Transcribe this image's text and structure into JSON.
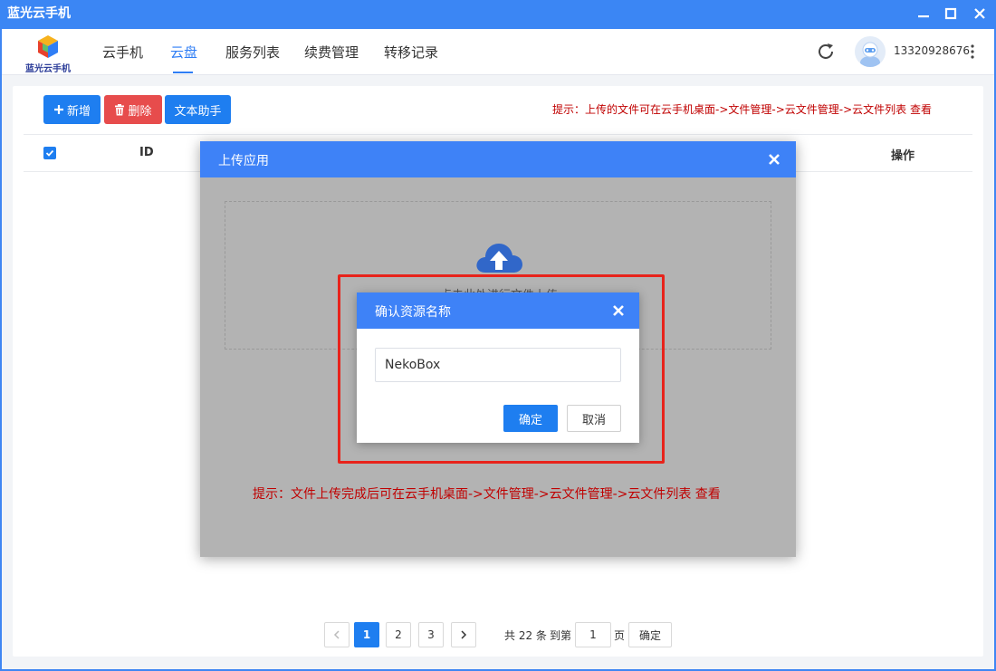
{
  "window": {
    "title": "蓝光云手机",
    "minimize_icon": "minimize-icon",
    "maximize_icon": "maximize-icon",
    "close_icon": "close-icon"
  },
  "header": {
    "logo_text": "蓝光云手机",
    "nav": [
      {
        "label": "云手机",
        "active": false
      },
      {
        "label": "云盘",
        "active": true
      },
      {
        "label": "服务列表",
        "active": false
      },
      {
        "label": "续费管理",
        "active": false
      },
      {
        "label": "转移记录",
        "active": false
      }
    ],
    "user_phone": "13320928676",
    "accent_color": "#2f7ef5"
  },
  "toolbar": {
    "add_label": "新增",
    "delete_label": "删除",
    "text_helper_label": "文本助手",
    "tip": "提示：上传的文件可在云手机桌面->文件管理->云文件管理->云文件列表 查看"
  },
  "table": {
    "columns": [
      "ID",
      "操作"
    ],
    "select_all_checked": true
  },
  "pagination": {
    "pages": [
      "1",
      "2",
      "3"
    ],
    "current_page": "1",
    "total_text_prefix": "共 22 条",
    "goto_label": "到第",
    "goto_value": "1",
    "page_unit": "页",
    "confirm_label": "确定"
  },
  "upload_modal": {
    "title": "上传应用",
    "drop_text": "点击此处进行文件上传",
    "tip": "提示：文件上传完成后可在云手机桌面->文件管理->云文件管理->云文件列表 查看"
  },
  "confirm_dialog": {
    "title": "确认资源名称",
    "input_value": "NekoBox",
    "ok_label": "确定",
    "cancel_label": "取消"
  },
  "colors": {
    "title_bar": "#3b86f4",
    "primary": "#1e7ef0",
    "danger": "#e74c4c",
    "tip_red": "#c00000",
    "highlight_red": "#e8231b"
  }
}
